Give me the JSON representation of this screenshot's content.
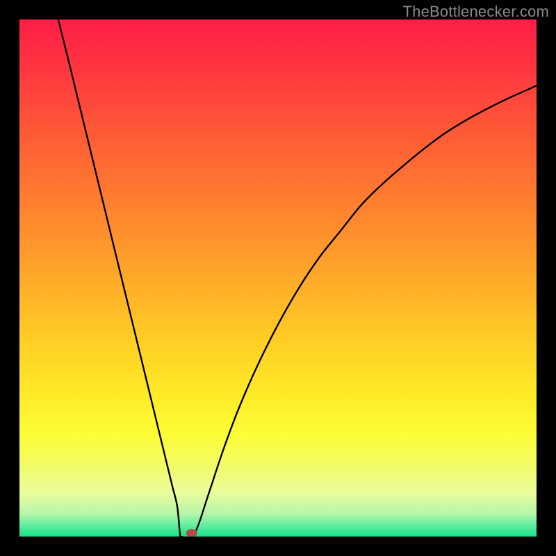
{
  "watermark": "TheBottlenecker.com",
  "chart_data": {
    "type": "line",
    "title": "",
    "xlabel": "",
    "ylabel": "",
    "xlim": [
      0,
      1
    ],
    "ylim": [
      0,
      1
    ],
    "legend": false,
    "grid": false,
    "notch": {
      "x": 0.312,
      "y": 0.0
    },
    "marker": {
      "x": 0.333,
      "y": 0.0,
      "color": "#b54b47"
    },
    "series": [
      {
        "name": "bottleneck-curve",
        "color": "#000000",
        "points": [
          {
            "x": 0.075,
            "y": 1.0
          },
          {
            "x": 0.095,
            "y": 0.92
          },
          {
            "x": 0.115,
            "y": 0.838
          },
          {
            "x": 0.135,
            "y": 0.756
          },
          {
            "x": 0.155,
            "y": 0.674
          },
          {
            "x": 0.175,
            "y": 0.592
          },
          {
            "x": 0.195,
            "y": 0.51
          },
          {
            "x": 0.215,
            "y": 0.428
          },
          {
            "x": 0.235,
            "y": 0.346
          },
          {
            "x": 0.255,
            "y": 0.264
          },
          {
            "x": 0.275,
            "y": 0.182
          },
          {
            "x": 0.295,
            "y": 0.1
          },
          {
            "x": 0.305,
            "y": 0.059
          },
          {
            "x": 0.31,
            "y": 0.01
          },
          {
            "x": 0.313,
            "y": 0.0
          },
          {
            "x": 0.333,
            "y": 0.0
          },
          {
            "x": 0.345,
            "y": 0.02
          },
          {
            "x": 0.365,
            "y": 0.08
          },
          {
            "x": 0.395,
            "y": 0.17
          },
          {
            "x": 0.425,
            "y": 0.25
          },
          {
            "x": 0.46,
            "y": 0.33
          },
          {
            "x": 0.5,
            "y": 0.41
          },
          {
            "x": 0.54,
            "y": 0.48
          },
          {
            "x": 0.58,
            "y": 0.54
          },
          {
            "x": 0.62,
            "y": 0.59
          },
          {
            "x": 0.66,
            "y": 0.64
          },
          {
            "x": 0.7,
            "y": 0.68
          },
          {
            "x": 0.74,
            "y": 0.715
          },
          {
            "x": 0.78,
            "y": 0.748
          },
          {
            "x": 0.82,
            "y": 0.778
          },
          {
            "x": 0.86,
            "y": 0.803
          },
          {
            "x": 0.9,
            "y": 0.825
          },
          {
            "x": 0.94,
            "y": 0.845
          },
          {
            "x": 0.98,
            "y": 0.863
          },
          {
            "x": 1.0,
            "y": 0.872
          }
        ]
      }
    ],
    "background_gradient": {
      "stops": [
        {
          "offset": 0.0,
          "color": "#ff1e46"
        },
        {
          "offset": 0.1,
          "color": "#ff3740"
        },
        {
          "offset": 0.22,
          "color": "#ff5a36"
        },
        {
          "offset": 0.35,
          "color": "#ff7e2f"
        },
        {
          "offset": 0.48,
          "color": "#ffa32a"
        },
        {
          "offset": 0.6,
          "color": "#ffc826"
        },
        {
          "offset": 0.72,
          "color": "#ffe927"
        },
        {
          "offset": 0.8,
          "color": "#fdfd35"
        },
        {
          "offset": 0.86,
          "color": "#f3fb63"
        },
        {
          "offset": 0.915,
          "color": "#eafc9c"
        },
        {
          "offset": 0.955,
          "color": "#b7f6a9"
        },
        {
          "offset": 0.978,
          "color": "#63eea0"
        },
        {
          "offset": 1.0,
          "color": "#14e389"
        }
      ]
    }
  }
}
